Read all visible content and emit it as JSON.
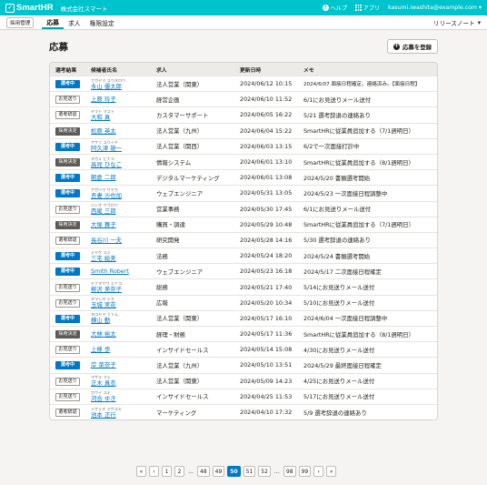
{
  "header": {
    "logo": "SmartHR",
    "company": "株式会社スマート",
    "help": "ヘルプ",
    "apps": "アプリ",
    "email": "kasumi.iwashita@example.com"
  },
  "subnav": {
    "tag": "採用管理",
    "tabs": [
      "応募",
      "求人",
      "権限設定"
    ],
    "release": "リリースノート"
  },
  "page": {
    "title": "応募",
    "add_button": "応募を登録"
  },
  "table": {
    "headers": [
      "選考結果",
      "候補者氏名",
      "求人",
      "更新日時",
      "メモ"
    ],
    "rows": [
      {
        "status": "選考中",
        "kana": "ナガヤマ ユウタロウ",
        "name": "永山 優太郎",
        "job": "法人営業（関東）",
        "date": "2024/06/12 10:15",
        "memo": "2024/6/07 面接日程確定。連絡済み。【面接日程】"
      },
      {
        "status": "お見送り",
        "kana": "",
        "name": "上原 玲子",
        "job": "経営企画",
        "date": "2024/06/10 11:52",
        "memo": "6/1にお見送りメール送付"
      },
      {
        "status": "選考辞退",
        "kana": "ヤマト マコト",
        "name": "大和 真",
        "job": "カスタマーサポート",
        "date": "2024/06/05 16:22",
        "memo": "5/21 選考辞退の連絡あり"
      },
      {
        "status": "採用決定",
        "kana": "",
        "name": "松原 英太",
        "job": "法人営業（九州）",
        "date": "2024/06/04 15:22",
        "memo": "SmartHRに従業員追加する（7/1週明日）"
      },
      {
        "status": "選考中",
        "kana": "アサツ ユウイチ",
        "name": "阿久津 雄一",
        "job": "法人営業（関西）",
        "date": "2024/06/03 13:15",
        "memo": "6/2で一次面接打診中"
      },
      {
        "status": "採用決定",
        "kana": "タカミ ヒナコ",
        "name": "高見 ひなこ",
        "job": "情報システム",
        "date": "2024/06/01 13:10",
        "memo": "SmartHRに従業員追加する（8/1週明日）"
      },
      {
        "status": "選考中",
        "kana": "",
        "name": "朝倉 二郎",
        "job": "デジタルマーケティング",
        "date": "2024/06/01 13:08",
        "memo": "2024/5/20 書類選考開始"
      },
      {
        "status": "選考中",
        "kana": "アガツマ サヤカ",
        "name": "吾妻 沙也加",
        "job": "ウェブエンジニア",
        "date": "2024/05/31 13:05",
        "memo": "2024/5/23 一次面接日程調整中"
      },
      {
        "status": "お見送り",
        "kana": "ニシオ サブロウ",
        "name": "西尾 三郎",
        "job": "営業事務",
        "date": "2024/05/30 17:45",
        "memo": "6/1にお見送りメール送付"
      },
      {
        "status": "採用決定",
        "kana": "",
        "name": "大塚 舞子",
        "job": "購買・調達",
        "date": "2024/05/29 10:48",
        "memo": "SmartHRに従業員追加する（7/1週明日）"
      },
      {
        "status": "選考辞退",
        "kana": "",
        "name": "長谷川 一夫",
        "job": "研究開発",
        "date": "2024/05/28 14:16",
        "memo": "5/30 選考辞退の連絡あり"
      },
      {
        "status": "選考中",
        "kana": "ミヤケ ユミ",
        "name": "三宅 絵美",
        "job": "法務",
        "date": "2024/05/24 18:20",
        "memo": "2024/5/24 書類選考開始"
      },
      {
        "status": "選考中",
        "kana": "",
        "name": "Smith Robert",
        "job": "ウェブエンジニア",
        "date": "2024/05/23 16:18",
        "memo": "2024/5/17 二次面接日程確定"
      },
      {
        "status": "お見送り",
        "kana": "ヤナギサワ ミナコ",
        "name": "柳沢 美奈子",
        "job": "総務",
        "date": "2024/05/21 17:40",
        "memo": "5/14にお見送りメール送付"
      },
      {
        "status": "お見送り",
        "kana": "タマシロ ミカ",
        "name": "玉城 実花",
        "job": "広報",
        "date": "2024/05/20 10:34",
        "memo": "5/10にお見送りメール送付"
      },
      {
        "status": "選考中",
        "kana": "ヨコヤマ ツトム",
        "name": "横山 勤",
        "job": "法人営業（関東）",
        "date": "2024/05/17 16:10",
        "memo": "2024/6/04 一次面接日程調整中"
      },
      {
        "status": "採用決定",
        "kana": "",
        "name": "大林 裕太",
        "job": "経理・財務",
        "date": "2024/05/17 11:36",
        "memo": "SmartHRに従業員追加する（8/1週明日）"
      },
      {
        "status": "お見送り",
        "kana": "",
        "name": "上條 歩",
        "job": "インサイドセールス",
        "date": "2024/05/14 15:08",
        "memo": "4/30にお見送りメール送付"
      },
      {
        "status": "選考中",
        "kana": "",
        "name": "岸 菜奈子",
        "job": "法人営業（九州）",
        "date": "2024/05/10 13:51",
        "memo": "2024/5/29 最終面接日程確定"
      },
      {
        "status": "お見送り",
        "kana": "マサキ マミ",
        "name": "正木 真衣",
        "job": "法人営業（関東）",
        "date": "2024/05/09 14:23",
        "memo": "4/25にお見送りメール送付"
      },
      {
        "status": "お見送り",
        "kana": "カワイ ユキ",
        "name": "河合 ゆき",
        "job": "インサイドセールス",
        "date": "2024/04/25 11:53",
        "memo": "5/17にお見送りメール送付"
      },
      {
        "status": "選考辞退",
        "kana": "イケミチ マサユキ",
        "name": "池本 正行",
        "job": "マーケティング",
        "date": "2024/04/10 17:32",
        "memo": "5/9 選考辞退の連絡あり"
      }
    ]
  },
  "pagination": {
    "first": "«",
    "prev": "‹",
    "pages": [
      "1",
      "2",
      "…",
      "48",
      "49",
      "50",
      "51",
      "52",
      "…",
      "98",
      "99"
    ],
    "current": "50",
    "next": "›",
    "last": "»"
  },
  "colors": {
    "brand": "#00c4cc",
    "link": "#0077c7",
    "decided": "#5d5a56"
  }
}
